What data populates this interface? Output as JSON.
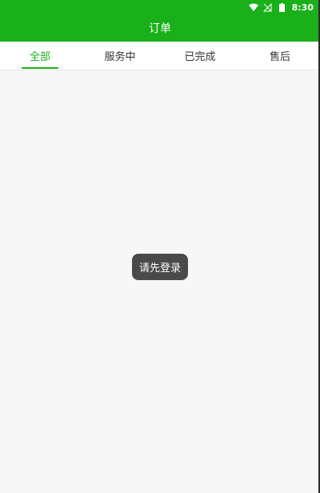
{
  "status_bar": {
    "time": "8:30",
    "icons": [
      "wifi-icon",
      "no-signal-icon",
      "battery-icon"
    ]
  },
  "app_bar": {
    "title": "订单"
  },
  "tabs": [
    {
      "label": "全部",
      "active": true
    },
    {
      "label": "服务中",
      "active": false
    },
    {
      "label": "已完成",
      "active": false
    },
    {
      "label": "售后",
      "active": false
    }
  ],
  "toast": {
    "message": "请先登录"
  },
  "colors": {
    "brand": "#19b019",
    "toast_bg": "#4a4a4a",
    "page_bg": "#f7f7f7"
  }
}
